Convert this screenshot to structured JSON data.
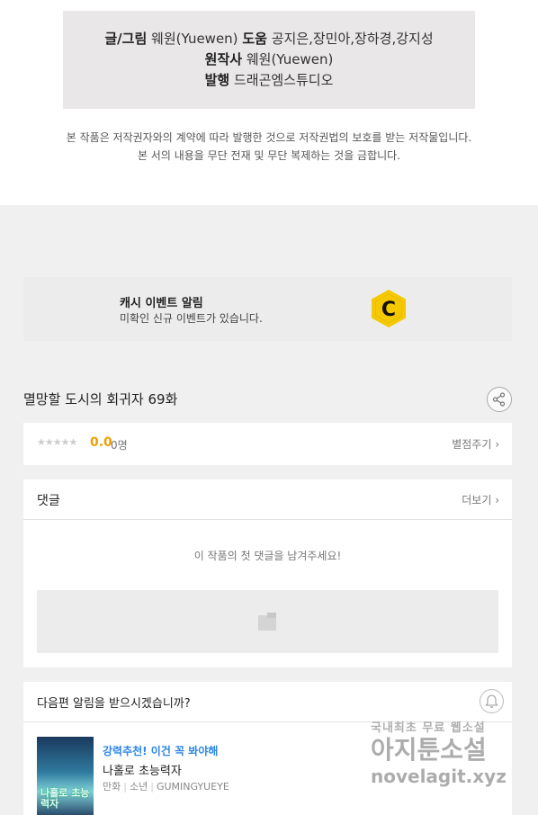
{
  "credits": {
    "art_label": "글/그림",
    "art_value": "웨원(Yuewen)",
    "assist_label": "도움",
    "assist_value": "공지은,장민아,장하경,강지성",
    "original_label": "원작사",
    "original_value": "웨원(Yuewen)",
    "publisher_label": "발행",
    "publisher_value": "드래곤엠스튜디오"
  },
  "copyright": {
    "line1": "본 작품은 저작권자와의 계약에 따라 발행한 것으로 저작권법의 보호를 받는 저작물입니다.",
    "line2": "본 서의 내용을 무단 전재 및 무단 복제하는 것을 금합니다."
  },
  "event": {
    "title": "캐시 이벤트 알림",
    "description": "미확인 신규 이벤트가 있습니다.",
    "icon_letter": "C",
    "icon_color": "#f5c800"
  },
  "episode": {
    "title": "멸망할 도시의 회귀자 69화"
  },
  "rating": {
    "stars": "★★★★★",
    "score": "0.0",
    "count": "0명",
    "rate_link": "별점주기 ›"
  },
  "comments": {
    "title": "댓글",
    "more_link": "더보기 ›",
    "empty_message": "이 작품의 첫 댓글을 남겨주세요!"
  },
  "notify": {
    "title": "다음편 알림을 받으시겠습니까?"
  },
  "recommendation": {
    "tag": "강력추천! 이건 꼭 봐야해",
    "title": "나홀로 초능력자",
    "meta_type": "만화",
    "meta_genre": "소년",
    "meta_author": "GUMINGYUEYE",
    "thumb_text": "나홀로 초능력자",
    "tag_color": "#2b86e8"
  },
  "watermark": {
    "line1": "국내최초 무료 웹소설",
    "line2": "아지툰소설",
    "line3": "novelagit.xyz"
  }
}
